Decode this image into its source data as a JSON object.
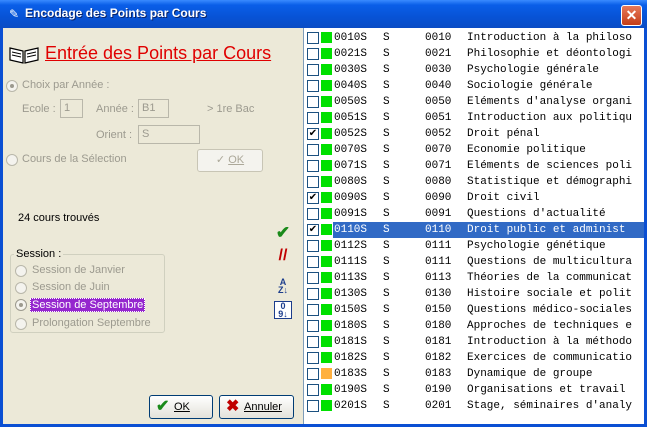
{
  "window": {
    "title": "Encodage des Points par Cours"
  },
  "heading": "Entrée des Points par Cours",
  "mode": {
    "by_year_label": "Choix par Année :",
    "ecole_label": "Ecole :",
    "ecole_value": "1",
    "annee_label": "Année :",
    "annee_value": "B1",
    "annee_desc": "> 1re Bac",
    "orient_label": "Orient :",
    "orient_value": "S",
    "selection_label": "Cours de la Sélection",
    "ok_label": "OK"
  },
  "found_text": "24 cours trouvés",
  "session": {
    "title": "Session :",
    "options": [
      "Session de Janvier",
      "Session de Juin",
      "Session de Septembre",
      "Prolongation Septembre"
    ],
    "selected": "Session de Septembre"
  },
  "buttons": {
    "ok": "OK",
    "cancel": "Annuler"
  },
  "icons": {
    "check_all": "green-check-icon",
    "uncheck_all": "red-double-slash-icon",
    "sort_alpha": "sort-az-icon",
    "sort_num": "sort-09-icon"
  },
  "colors": {
    "status_green": "#00e000",
    "status_orange": "#ffb040",
    "selection": "#316ac5",
    "session_highlight": "#9526ce"
  },
  "courses": [
    {
      "checked": false,
      "status": "green",
      "code": "0010S",
      "orient": "S",
      "num": "0010",
      "title": "Introduction à la philoso"
    },
    {
      "checked": false,
      "status": "green",
      "code": "0021S",
      "orient": "S",
      "num": "0021",
      "title": "Philosophie et déontologi"
    },
    {
      "checked": false,
      "status": "green",
      "code": "0030S",
      "orient": "S",
      "num": "0030",
      "title": "Psychologie générale"
    },
    {
      "checked": false,
      "status": "green",
      "code": "0040S",
      "orient": "S",
      "num": "0040",
      "title": "Sociologie générale"
    },
    {
      "checked": false,
      "status": "green",
      "code": "0050S",
      "orient": "S",
      "num": "0050",
      "title": "Eléments d'analyse organi"
    },
    {
      "checked": false,
      "status": "green",
      "code": "0051S",
      "orient": "S",
      "num": "0051",
      "title": "Introduction aux politiqu"
    },
    {
      "checked": true,
      "status": "green",
      "code": "0052S",
      "orient": "S",
      "num": "0052",
      "title": "Droit pénal"
    },
    {
      "checked": false,
      "status": "green",
      "code": "0070S",
      "orient": "S",
      "num": "0070",
      "title": "Economie politique"
    },
    {
      "checked": false,
      "status": "green",
      "code": "0071S",
      "orient": "S",
      "num": "0071",
      "title": "Eléments de sciences poli"
    },
    {
      "checked": false,
      "status": "green",
      "code": "0080S",
      "orient": "S",
      "num": "0080",
      "title": "Statistique et démographi"
    },
    {
      "checked": true,
      "status": "green",
      "code": "0090S",
      "orient": "S",
      "num": "0090",
      "title": "Droit civil"
    },
    {
      "checked": false,
      "status": "green",
      "code": "0091S",
      "orient": "S",
      "num": "0091",
      "title": "Questions d'actualité"
    },
    {
      "checked": true,
      "status": "green",
      "code": "0110S",
      "orient": "S",
      "num": "0110",
      "title": "Droit public et administ",
      "selected": true
    },
    {
      "checked": false,
      "status": "green",
      "code": "0112S",
      "orient": "S",
      "num": "0111",
      "title": "Psychologie génétique"
    },
    {
      "checked": false,
      "status": "green",
      "code": "0111S",
      "orient": "S",
      "num": "0111",
      "title": "Questions de multicultura"
    },
    {
      "checked": false,
      "status": "green",
      "code": "0113S",
      "orient": "S",
      "num": "0113",
      "title": "Théories de la communicat"
    },
    {
      "checked": false,
      "status": "green",
      "code": "0130S",
      "orient": "S",
      "num": "0130",
      "title": "Histoire sociale et polit"
    },
    {
      "checked": false,
      "status": "green",
      "code": "0150S",
      "orient": "S",
      "num": "0150",
      "title": "Questions médico-sociales"
    },
    {
      "checked": false,
      "status": "green",
      "code": "0180S",
      "orient": "S",
      "num": "0180",
      "title": "Approches de techniques e"
    },
    {
      "checked": false,
      "status": "green",
      "code": "0181S",
      "orient": "S",
      "num": "0181",
      "title": "Introduction à la méthodo"
    },
    {
      "checked": false,
      "status": "green",
      "code": "0182S",
      "orient": "S",
      "num": "0182",
      "title": "Exercices de communicatio"
    },
    {
      "checked": false,
      "status": "orange",
      "code": "0183S",
      "orient": "S",
      "num": "0183",
      "title": "Dynamique de groupe"
    },
    {
      "checked": false,
      "status": "green",
      "code": "0190S",
      "orient": "S",
      "num": "0190",
      "title": "Organisations et travail"
    },
    {
      "checked": false,
      "status": "green",
      "code": "0201S",
      "orient": "S",
      "num": "0201",
      "title": "Stage, séminaires d'analy"
    }
  ]
}
